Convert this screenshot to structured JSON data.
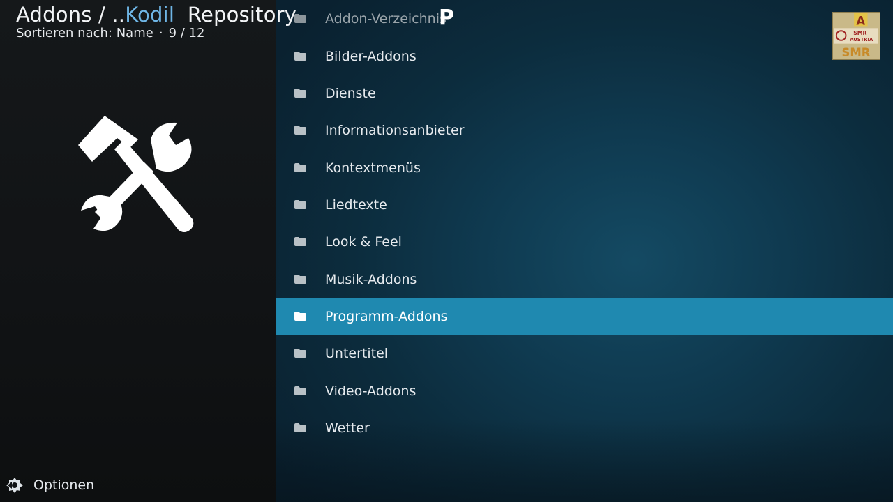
{
  "header": {
    "title_prefix": "Addons / ..",
    "title_accent": "Kodil",
    "title_suffix": "Repository",
    "sort_label": "Sortieren nach: Name",
    "sort_separator": "·",
    "position": "9 / 12"
  },
  "list": {
    "items": [
      {
        "label": "Addon-Verzeichnis"
      },
      {
        "label": "Bilder-Addons"
      },
      {
        "label": "Dienste"
      },
      {
        "label": "Informationsanbieter"
      },
      {
        "label": "Kontextmenüs"
      },
      {
        "label": "Liedtexte"
      },
      {
        "label": "Look & Feel"
      },
      {
        "label": "Musik-Addons"
      },
      {
        "label": "Programm-Addons"
      },
      {
        "label": "Untertitel"
      },
      {
        "label": "Video-Addons"
      },
      {
        "label": "Wetter"
      }
    ],
    "selected_index": 8,
    "letter_hint": "P"
  },
  "icons": {
    "tools": "hammer-wrench-icon",
    "folder": "folder-icon",
    "options": "options-gear-icon"
  },
  "colors": {
    "accent": "#6fb6e6",
    "selection": "#1f89b0"
  },
  "footer": {
    "options_label": "Optionen"
  },
  "logo": {
    "letters": [
      "A",
      "SMR",
      "AUSTRIA"
    ]
  }
}
